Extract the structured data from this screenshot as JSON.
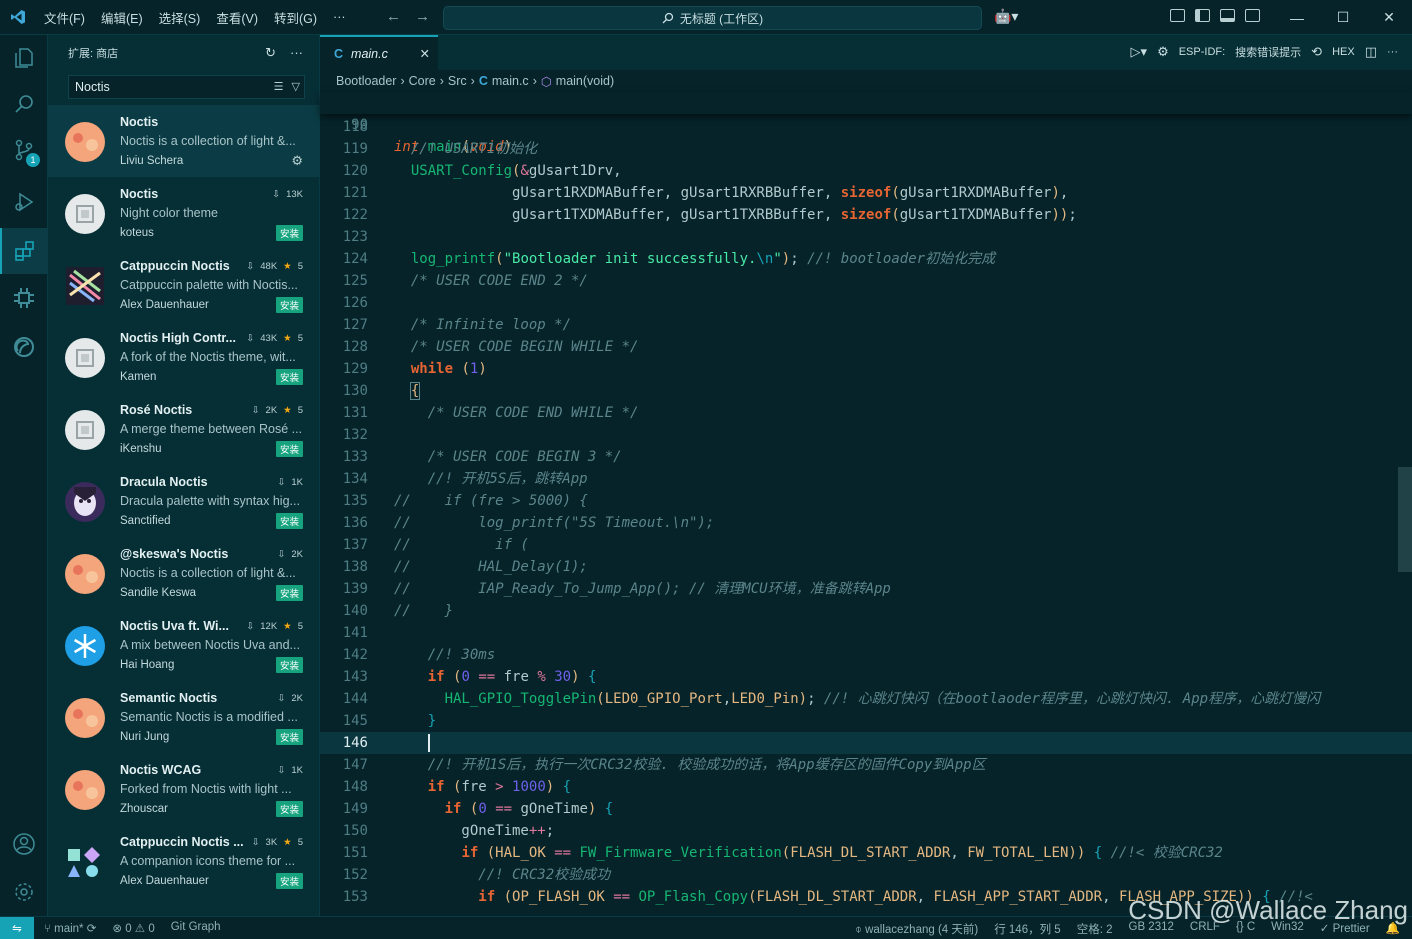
{
  "titlebar": {
    "menus": [
      "文件(F)",
      "编辑(E)",
      "选择(S)",
      "查看(V)",
      "转到(G)",
      "···"
    ],
    "command_center": "无标题 (工作区)"
  },
  "sidebar": {
    "header": "扩展: 商店",
    "search_value": "Noctis",
    "extensions": [
      {
        "name": "Noctis",
        "desc": "Noctis is a collection of light &...",
        "publisher": "Liviu Schera",
        "downloads": "",
        "rating": "",
        "action": "gear",
        "logo": "noctis-logo-icon"
      },
      {
        "name": "Noctis",
        "desc": "Night color theme",
        "publisher": "koteus",
        "downloads": "13K",
        "rating": "",
        "action": "安装",
        "logo": "generic-extension-icon"
      },
      {
        "name": "Catppuccin Noctis",
        "desc": "Catppuccin palette with Noctis...",
        "publisher": "Alex Dauenhauer",
        "downloads": "48K",
        "rating": "5",
        "action": "安装",
        "logo": "catppuccin-logo-icon"
      },
      {
        "name": "Noctis High Contr...",
        "desc": "A fork of the Noctis theme, wit...",
        "publisher": "Kamen",
        "downloads": "43K",
        "rating": "5",
        "action": "安装",
        "logo": "generic-extension-icon"
      },
      {
        "name": "Rosé Noctis",
        "desc": "A merge theme between Rosé ...",
        "publisher": "iKenshu",
        "downloads": "2K",
        "rating": "5",
        "action": "安装",
        "logo": "generic-extension-icon"
      },
      {
        "name": "Dracula Noctis",
        "desc": "Dracula palette with syntax hig...",
        "publisher": "Sanctified",
        "downloads": "1K",
        "rating": "",
        "action": "安装",
        "logo": "dracula-logo-icon"
      },
      {
        "name": "@skeswa's Noctis",
        "desc": "Noctis is a collection of light &...",
        "publisher": "Sandile Keswa",
        "downloads": "2K",
        "rating": "",
        "action": "安装",
        "logo": "noctis-logo-icon"
      },
      {
        "name": "Noctis Uva ft. Wi...",
        "desc": "A mix between Noctis Uva and...",
        "publisher": "Hai Hoang",
        "downloads": "12K",
        "rating": "5",
        "action": "安装",
        "logo": "snowflake-logo-icon"
      },
      {
        "name": "Semantic Noctis",
        "desc": "Semantic Noctis is a modified ...",
        "publisher": "Nuri Jung",
        "downloads": "2K",
        "rating": "",
        "action": "安装",
        "logo": "noctis-logo-icon"
      },
      {
        "name": "Noctis WCAG",
        "desc": "Forked from Noctis with light ...",
        "publisher": "Zhouscar",
        "downloads": "1K",
        "rating": "",
        "action": "安装",
        "logo": "noctis-logo-icon"
      },
      {
        "name": "Catppuccin Noctis ...",
        "desc": "A companion icons theme for ...",
        "publisher": "Alex Dauenhauer",
        "downloads": "3K",
        "rating": "5",
        "action": "安装",
        "logo": "shapes-logo-icon"
      }
    ]
  },
  "editor": {
    "tab": "main.c",
    "actions": {
      "espidf": "ESP-IDF:",
      "search_error": "搜索错误提示",
      "hex": "HEX"
    },
    "breadcrumbs": [
      "Bootloader",
      "Core",
      "Src",
      "main.c",
      "main(void)"
    ],
    "sticky_ln": "90",
    "current_line": "146",
    "line_numbers": [
      "118",
      "119",
      "120",
      "121",
      "122",
      "123",
      "124",
      "125",
      "126",
      "127",
      "128",
      "129",
      "130",
      "131",
      "132",
      "133",
      "134",
      "135",
      "136",
      "137",
      "138",
      "139",
      "140",
      "141",
      "142",
      "143",
      "144",
      "145",
      "146",
      "147",
      "148",
      "149",
      "150",
      "151",
      "152",
      "153"
    ]
  },
  "statusbar": {
    "branch": "main*",
    "problems": "0",
    "warnings": "0",
    "gitgraph": "Git Graph",
    "author": "wallacezhang (4 天前)",
    "position": "行 146，列 5",
    "spaces": "空格: 2",
    "encoding": "GB 2312",
    "eol": "CRLF",
    "lang": "C",
    "platform": "Win32",
    "prettier": "Prettier"
  },
  "watermark": "CSDN @Wallace Zhang",
  "colors": {
    "accent": "#16a3b6",
    "background": "#052329",
    "sidebar": "#062e35",
    "install": "#16a37e"
  }
}
